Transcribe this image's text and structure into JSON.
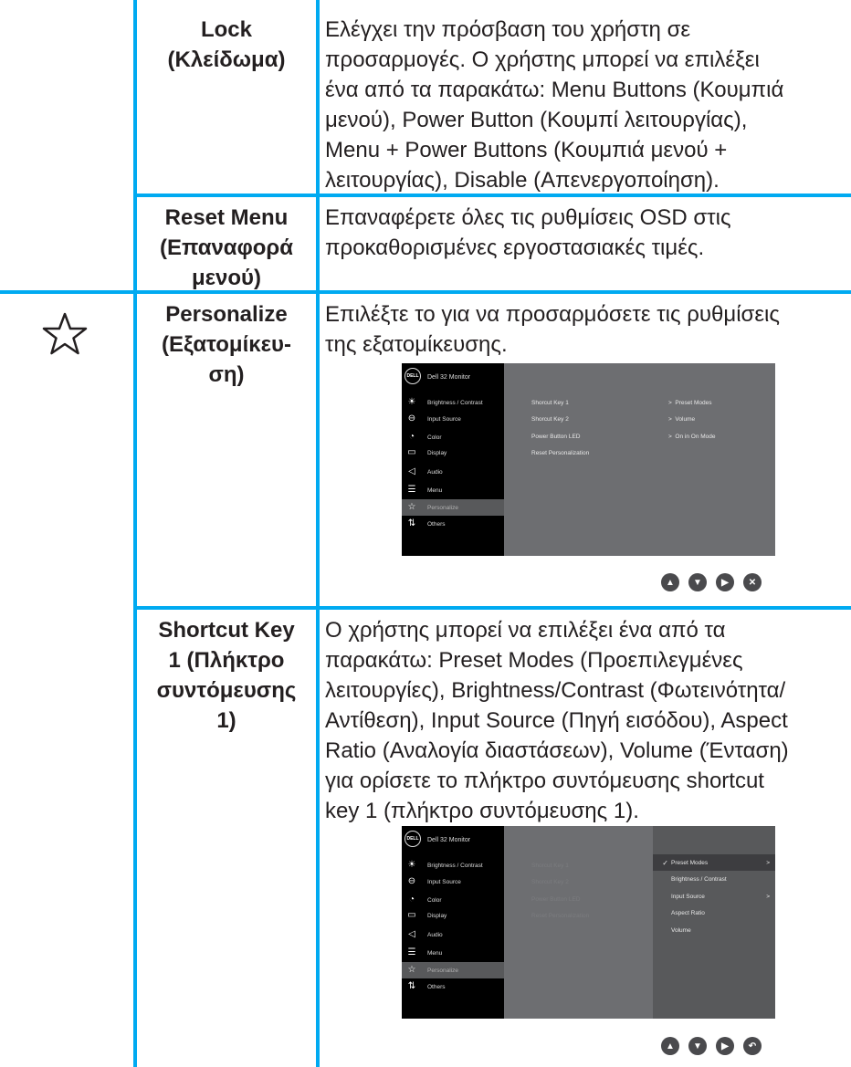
{
  "rows": [
    {
      "name": "Lock\n(Κλείδωμα)",
      "desc": "Ελέγχει την πρόσβαση του χρήστη σε\nπροσαρμογές. Ο χρήστης μπορεί να επιλέξει\nένα από τα παρακάτω: Menu Buttons (Κουμπιά\nμενού), Power Button (Κουμπί λειτουργίας),\nMenu + Power Buttons (Κουμπιά μενού +\nλειτουργίας), Disable (Απενεργοποίηση)."
    },
    {
      "name": "Reset Menu\n(Επαναφορά\nμενού)",
      "desc": "Επαναφέρετε όλες τις ρυθμίσεις OSD στις\nπροκαθορισμένες εργοστασιακές τιμές."
    },
    {
      "name": "Personalize\n(Εξατομίκευ-\nση)",
      "desc": "Επιλέξτε το για να προσαρμόσετε τις ρυθμίσεις\nτης εξατομίκευσης."
    },
    {
      "name": "Shortcut Key\n1 (Πλήκτρο\nσυντόμευσης\n1)",
      "desc": "Ο χρήστης μπορεί να επιλέξει ένα από τα\nπαρακάτω: Preset Modes (Προεπιλεγμένες\nλειτουργίες), Brightness/Contrast (Φωτεινότητα/\nΑντίθεση), Input Source (Πηγή εισόδου), Aspect\nRatio (Αναλογία διαστάσεων), Volume (Ένταση)\nγια ορίσετε το πλήκτρο συντόμευσης shortcut\nkey 1 (πλήκτρο συντόμευσης 1)."
    }
  ],
  "osd": {
    "logo": "DELL",
    "title": "Dell 32 Monitor",
    "menu": [
      "Brightness / Contrast",
      "Input Source",
      "Color",
      "Display",
      "Audio",
      "Menu",
      "Personalize",
      "Others"
    ],
    "settings": [
      "Shorcut Key 1",
      "Shorcut Key 2",
      "Power Button LED",
      "Reset Personalization"
    ],
    "values": [
      "Preset Modes",
      "Volume",
      "On in On Mode"
    ],
    "submenu": [
      "Preset Modes",
      "Brightness / Contrast",
      "Input Source",
      "Aspect Ratio",
      "Volume"
    ]
  }
}
